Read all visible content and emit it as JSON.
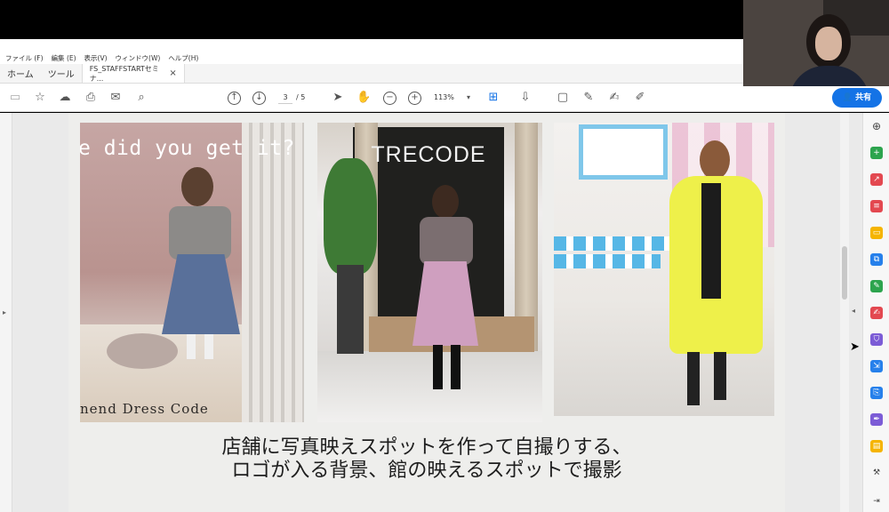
{
  "menu": [
    "ファイル (F)",
    "編集 (E)",
    "表示(V)",
    "ウィンドウ(W)",
    "ヘルプ(H)"
  ],
  "tabs": {
    "home": "ホーム",
    "tools": "ツール",
    "document": "FS_STAFFSTARTセミナ...",
    "close": "×"
  },
  "toolbar": {
    "page_current": "3",
    "page_total": "/ 5",
    "zoom": "113%",
    "share_label": "共有"
  },
  "slide": {
    "photo1_text": "e did you get it?",
    "photo1_sign": "nend Dress Code",
    "photo2_logo": "TRECODE",
    "caption_line1": "店舗に写真映えスポットを作って自撮りする、",
    "caption_line2": "ロゴが入る背景、館の映えるスポットで撮影"
  },
  "colors": {
    "accent": "#1473e6",
    "viewer_bg": "#eaeaea",
    "coat_yellow": "#eef04a"
  }
}
